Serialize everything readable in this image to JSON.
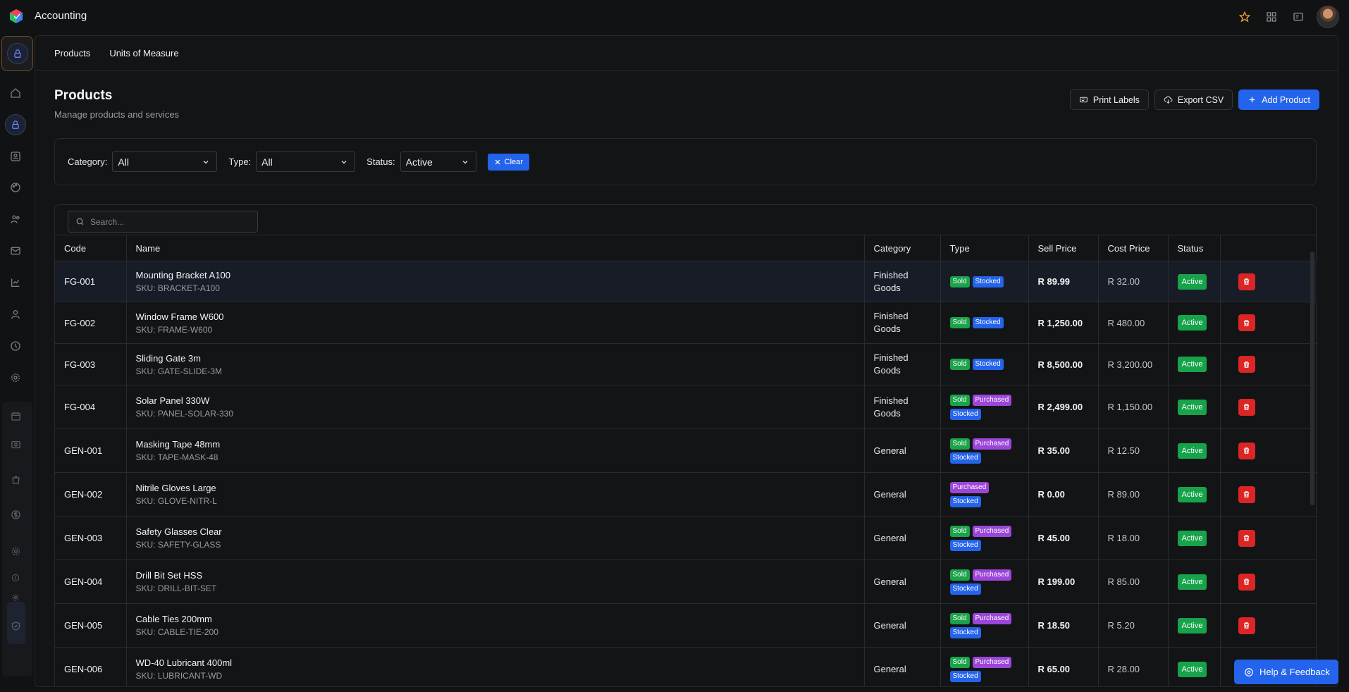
{
  "app": {
    "title": "Accounting"
  },
  "tabs": [
    {
      "label": "Products"
    },
    {
      "label": "Units of Measure"
    }
  ],
  "page": {
    "title": "Products",
    "subtitle": "Manage products and services"
  },
  "actions": {
    "print_labels": "Print Labels",
    "export_csv": "Export CSV",
    "add_product": "Add Product"
  },
  "filters": {
    "category_label": "Category:",
    "category_value": "All",
    "type_label": "Type:",
    "type_value": "All",
    "status_label": "Status:",
    "status_value": "Active",
    "clear_label": "Clear"
  },
  "search": {
    "placeholder": "Search..."
  },
  "table": {
    "headers": [
      "Code",
      "Name",
      "Category",
      "Type",
      "Sell Price",
      "Cost Price",
      "Status",
      ""
    ],
    "rows": [
      {
        "code": "FG-001",
        "name": "Mounting Bracket A100",
        "sku": "SKU: BRACKET-A100",
        "category": [
          "Finished",
          "Goods"
        ],
        "types": [
          "Sold",
          "Stocked"
        ],
        "sell": "R 89.99",
        "cost": "R 32.00",
        "status": "Active"
      },
      {
        "code": "FG-002",
        "name": "Window Frame W600",
        "sku": "SKU: FRAME-W600",
        "category": [
          "Finished",
          "Goods"
        ],
        "types": [
          "Sold",
          "Stocked"
        ],
        "sell": "R 1,250.00",
        "cost": "R 480.00",
        "status": "Active"
      },
      {
        "code": "FG-003",
        "name": "Sliding Gate 3m",
        "sku": "SKU: GATE-SLIDE-3M",
        "category": [
          "Finished",
          "Goods"
        ],
        "types": [
          "Sold",
          "Stocked"
        ],
        "sell": "R 8,500.00",
        "cost": "R 3,200.00",
        "status": "Active"
      },
      {
        "code": "FG-004",
        "name": "Solar Panel 330W",
        "sku": "SKU: PANEL-SOLAR-330",
        "category": [
          "Finished",
          "Goods"
        ],
        "types": [
          "Sold",
          "Purchased",
          "Stocked"
        ],
        "sell": "R 2,499.00",
        "cost": "R 1,150.00",
        "status": "Active"
      },
      {
        "code": "GEN-001",
        "name": "Masking Tape 48mm",
        "sku": "SKU: TAPE-MASK-48",
        "category": [
          "General"
        ],
        "types": [
          "Sold",
          "Purchased",
          "Stocked"
        ],
        "sell": "R 35.00",
        "cost": "R 12.50",
        "status": "Active"
      },
      {
        "code": "GEN-002",
        "name": "Nitrile Gloves Large",
        "sku": "SKU: GLOVE-NITR-L",
        "category": [
          "General"
        ],
        "types": [
          "Purchased",
          "Stocked"
        ],
        "sell": "R 0.00",
        "cost": "R 89.00",
        "status": "Active"
      },
      {
        "code": "GEN-003",
        "name": "Safety Glasses Clear",
        "sku": "SKU: SAFETY-GLASS",
        "category": [
          "General"
        ],
        "types": [
          "Sold",
          "Purchased",
          "Stocked"
        ],
        "sell": "R 45.00",
        "cost": "R 18.00",
        "status": "Active"
      },
      {
        "code": "GEN-004",
        "name": "Drill Bit Set HSS",
        "sku": "SKU: DRILL-BIT-SET",
        "category": [
          "General"
        ],
        "types": [
          "Sold",
          "Purchased",
          "Stocked"
        ],
        "sell": "R 199.00",
        "cost": "R 85.00",
        "status": "Active"
      },
      {
        "code": "GEN-005",
        "name": "Cable Ties 200mm",
        "sku": "SKU: CABLE-TIE-200",
        "category": [
          "General"
        ],
        "types": [
          "Sold",
          "Purchased",
          "Stocked"
        ],
        "sell": "R 18.50",
        "cost": "R 5.20",
        "status": "Active"
      },
      {
        "code": "GEN-006",
        "name": "WD-40 Lubricant 400ml",
        "sku": "SKU: LUBRICANT-WD",
        "category": [
          "General"
        ],
        "types": [
          "Sold",
          "Purchased",
          "Stocked"
        ],
        "sell": "R 65.00",
        "cost": "R 28.00",
        "status": "Active"
      }
    ]
  },
  "help": {
    "label": "Help & Feedback"
  },
  "colors": {
    "accent": "#2463eb",
    "sold": "#1aa34a",
    "purchased": "#9b45d9",
    "stocked": "#2463eb",
    "active": "#16a34a",
    "delete": "#dc2626"
  },
  "icons": {
    "topbar": [
      "star-icon",
      "grid-icon",
      "message-icon",
      "avatar"
    ],
    "rail": [
      "lock-icon",
      "home-icon",
      "lock-icon",
      "contact-icon",
      "palette-icon",
      "users-icon",
      "mail-icon",
      "analytics-icon",
      "person-icon",
      "clock-icon",
      "settings-icon",
      "calendar-icon",
      "camera-icon",
      "bag-icon",
      "dollar-icon",
      "gear-icon",
      "coin-icon",
      "cog-icon",
      "shield-icon"
    ]
  }
}
